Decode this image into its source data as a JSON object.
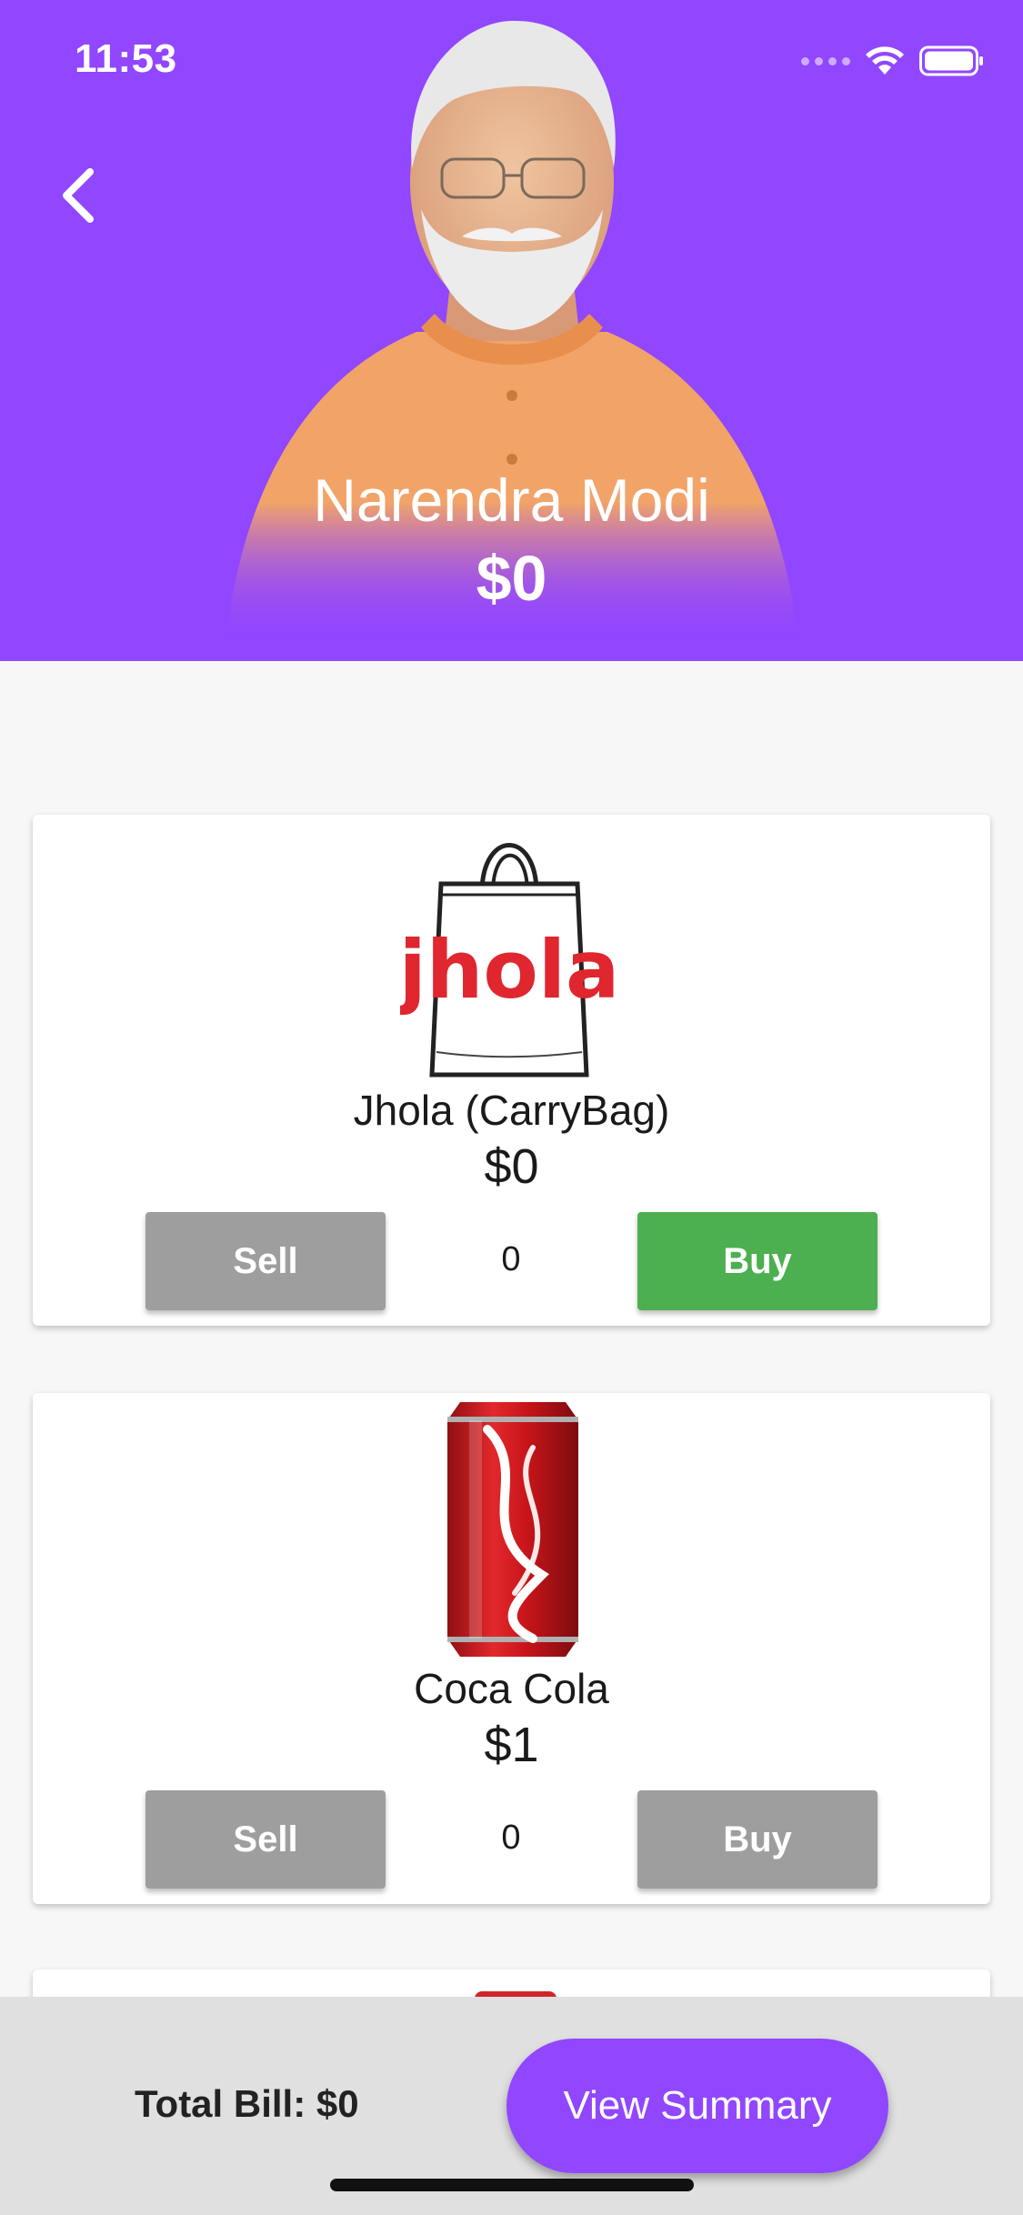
{
  "status_bar": {
    "time": "11:53"
  },
  "header": {
    "back_icon": "chevron-left-icon",
    "profile_name": "Narendra Modi",
    "profile_amount": "$0",
    "background_color": "#9146ff"
  },
  "items": [
    {
      "image_text": "jhola",
      "title": "Jhola (CarryBag)",
      "price": "$0",
      "sell_label": "Sell",
      "quantity": "0",
      "buy_label": "Buy",
      "buy_color": "#4caf50"
    },
    {
      "title": "Coca Cola",
      "price": "$1",
      "sell_label": "Sell",
      "quantity": "0",
      "buy_label": "Buy",
      "buy_color": "#9e9e9e"
    }
  ],
  "footer": {
    "total_bill": "Total Bill: $0",
    "view_summary_label": "View Summary"
  }
}
